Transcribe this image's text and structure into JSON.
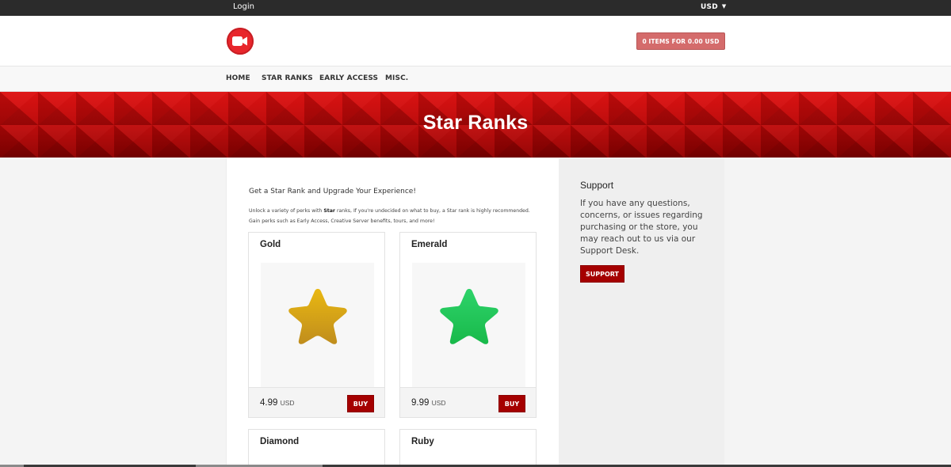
{
  "topbar": {
    "login_label": "Login",
    "currency": "USD"
  },
  "header": {
    "logo_icon": "video-camera-icon",
    "cart_label": "0 ITEMS FOR 0.00 USD",
    "accent_color": "#e8262c"
  },
  "nav": {
    "items": [
      {
        "label": "HOME"
      },
      {
        "label": "STAR RANKS"
      },
      {
        "label": "EARLY ACCESS"
      },
      {
        "label": "MISC."
      }
    ]
  },
  "hero": {
    "title": "Star Ranks",
    "color": "#b80000"
  },
  "main": {
    "intro": "Get a Star Rank and Upgrade Your Experience!",
    "desc_line1_pre": "Unlock a variety of perks with ",
    "desc_line1_bold": "Star",
    "desc_line1_post": " ranks, If you're undecided on what to buy, a Star rank is highly recommended.",
    "desc_line2": "Gain perks such as Early Access, Creative Server benefits, tours, and more!"
  },
  "products": [
    {
      "name": "Gold",
      "price": "4.99",
      "currency": "USD",
      "buy_label": "BUY",
      "icon": "gold-star-icon",
      "color": "#d4a017"
    },
    {
      "name": "Emerald",
      "price": "9.99",
      "currency": "USD",
      "buy_label": "BUY",
      "icon": "emerald-star-icon",
      "color": "#22c55e"
    },
    {
      "name": "Diamond"
    },
    {
      "name": "Ruby"
    }
  ],
  "sidebar": {
    "title": "Support",
    "text": "If you have any questions, concerns, or issues regarding purchasing or the store, you may reach out to us via our Support Desk.",
    "button_label": "SUPPORT"
  }
}
